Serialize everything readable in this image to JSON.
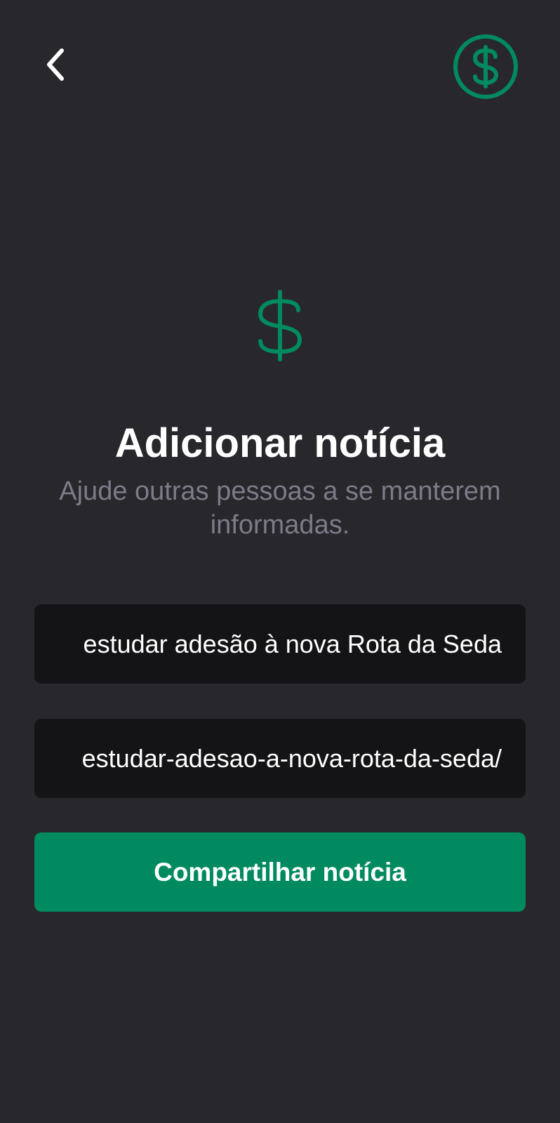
{
  "colors": {
    "background": "#28272c",
    "accent": "#018a5f",
    "field_background": "#141416",
    "subtitle": "#7c7b88",
    "text": "#ffffff"
  },
  "header": {
    "back_icon": "chevron-left-icon",
    "coin_icon": "dollar-circle-icon"
  },
  "hero": {
    "icon": "dollar-icon"
  },
  "main": {
    "title": "Adicionar notícia",
    "subtitle": "Ajude outras pessoas a se manterem informadas."
  },
  "form": {
    "title_value": "estudar adesão à nova Rota da Seda",
    "link_value": "estudar-adesao-a-nova-rota-da-seda/",
    "submit_label": "Compartilhar notícia"
  }
}
